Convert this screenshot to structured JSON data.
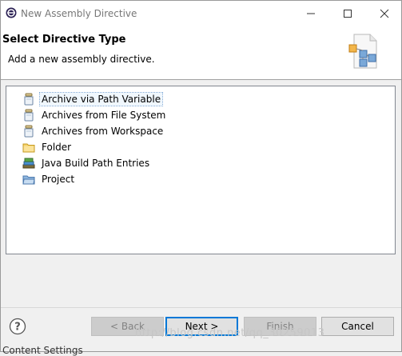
{
  "window": {
    "title": "New Assembly Directive"
  },
  "banner": {
    "title": "Select Directive Type",
    "description": "Add a new assembly directive."
  },
  "tree": {
    "items": [
      {
        "label": "Archive via Path Variable",
        "icon": "jar-icon",
        "selected": true
      },
      {
        "label": "Archives from File System",
        "icon": "jar-icon",
        "selected": false
      },
      {
        "label": "Archives from Workspace",
        "icon": "jar-icon",
        "selected": false
      },
      {
        "label": "Folder",
        "icon": "folder-icon",
        "selected": false
      },
      {
        "label": "Java Build Path Entries",
        "icon": "library-icon",
        "selected": false
      },
      {
        "label": "Project",
        "icon": "project-folder-icon",
        "selected": false
      }
    ]
  },
  "buttons": {
    "back": "< Back",
    "next": "Next >",
    "finish": "Finish",
    "cancel": "Cancel"
  },
  "watermark": "http://blog.csdn.net/qq_30259013",
  "clipped_text": "Content Settings",
  "colors": {
    "accent": "#0078d7",
    "selection": "#f0f7fd"
  }
}
